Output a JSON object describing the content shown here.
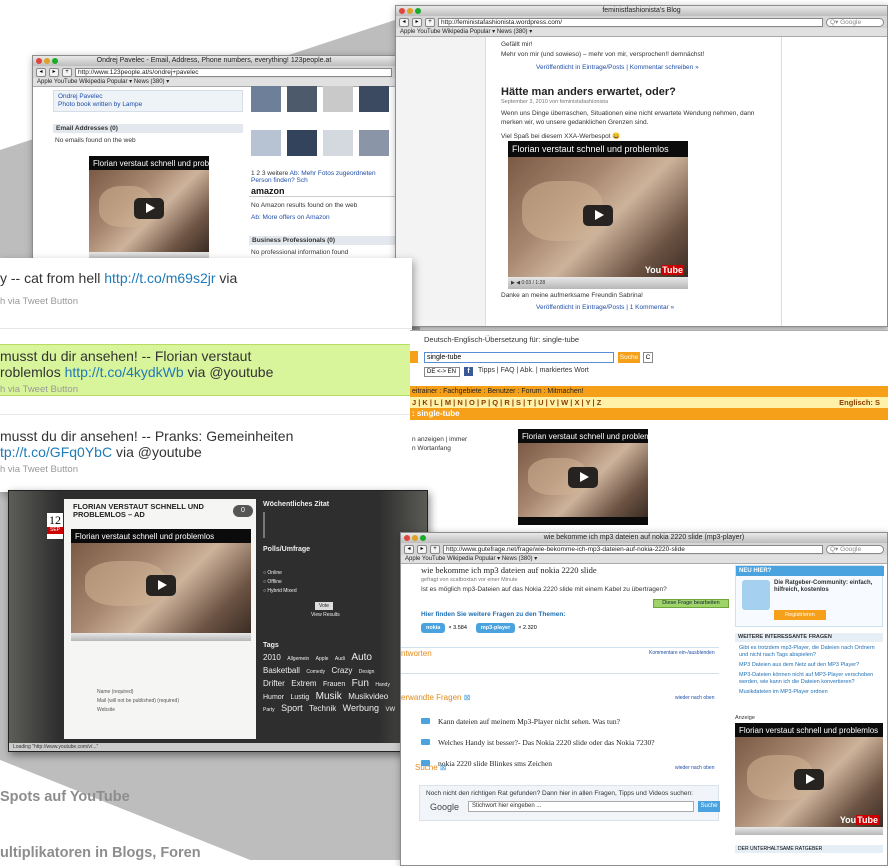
{
  "screen_123people": {
    "title": "Ondrej Pavelec - Email, Address, Phone numbers, everything! 123people.at",
    "url": "http://www.123people.at/s/ondrej+pavelec",
    "bookmarks": "Apple  YouTube  Wikipedia  Popular ▾  News (380) ▾",
    "link_top": "Ondrej Pavelec",
    "link_top2": "Photo book written by Lampe",
    "email_header": "Email Addresses (0)",
    "email_none": "No emails found on the web",
    "video_title": "Florian verstaut schnell und problemlos",
    "pagination": "1 2 3 weitere",
    "more_photos": "Ab: Mehr Fotos zugeordneten Person finden? Sch",
    "amazon_header": "amazon",
    "amazon_none": "No Amazon results found on the web",
    "amazon_link": "Ab: More offers on Amazon",
    "business_header": "Business Professionals (0)",
    "business_none": "No professional information found"
  },
  "screen_blog": {
    "title": "feministfashionista's Blog",
    "url": "http://feministafashionista.wordpress.com/",
    "search_placeholder": "Q▾ Google",
    "bookmarks": "Apple  YouTube  Wikipedia  Popular ▾  News (380) ▾",
    "prev_line1": "Gefällt mir!",
    "prev_line2": "Mehr von mir (und sowieso) – mehr von mir, versprochen!! demnächst!",
    "posted1": "Veröffentlicht in Eintrage/Posts | Kommentar schreiben »",
    "post_title": "Hätte man anders erwartet, oder?",
    "post_date": "September 3, 2010 von feministafashionista",
    "post_body": "Wenn uns Dinge überraschen, Situationen eine nicht erwartete Wendung nehmen, dann merken wir, wo unsere gedanklichen Grenzen sind.",
    "post_fun": "Viel Spaß bei diesem XXA-Werbespot 😀",
    "video_title": "Florian verstaut schnell und problemlos",
    "video_time": "0:03 / 1:28",
    "thanks": "Danke an meine aufmerksame Freundin Sabrina!",
    "posted2": "Veröffentlicht in Eintrage/Posts | 1 Kommentar »"
  },
  "tweets": [
    {
      "text": "y -- cat from hell ",
      "link": "http://t.co/m69s2jr",
      "after": " via",
      "meta": "h via Tweet Button"
    },
    {
      "text": "musst du dir ansehen! -- Florian verstaut",
      "text2": "roblemlos ",
      "link": "http://t.co/4kydkWb",
      "after": " via @youtube",
      "meta": "h via Tweet Button"
    },
    {
      "text": "musst du dir ansehen! -- Pranks: Gemeinheiten",
      "text2": "tp://t.co/GFq0YbC",
      "after": " via @youtube",
      "meta": "h via Tweet Button"
    }
  ],
  "screen_dict": {
    "heading": "Deutsch-Englisch-Übersetzung für: single-tube",
    "search_value": "single-tube",
    "search_button": "Suche",
    "lang_select": "DE <-> EN",
    "links": "Tipps | FAQ | Abk. | markiertes Wort",
    "nav": "eitrainer : Fachgebiete : Benutzer : Forum : Mitmachen!",
    "alphabet": "J | K | L | M | N | O | P | Q | R | S | T | U | V | W | X | Y | Z",
    "lang_right": "Englisch: S",
    "result": ": single-tube",
    "side1": "n anzeigen | immer",
    "side2": "n Wortanfang",
    "video_title": "Florian verstaut schnell und problemlos"
  },
  "screen_dark_blog": {
    "date_day": "12",
    "date_month": "SEP",
    "post_title": "FLORIAN VERSTAUT SCHNELL UND PROBLEMLOS – AD",
    "comments": "0",
    "video_title": "Florian verstaut schnell und problemlos",
    "sidebar_quote_title": "Wöchentliches Zitat",
    "poll_title": "Polls/Umfrage",
    "poll_options": [
      "Online",
      "Offline",
      "Hybrid Mixed"
    ],
    "vote_button": "Vote",
    "view_results": "View Results",
    "tags_title": "Tags",
    "tags": [
      "2010",
      "Allgemein",
      "Apple",
      "Audi",
      "Auto",
      "Basketball",
      "Comedy",
      "Crazy",
      "Design",
      "Drifter",
      "Extrem",
      "Frauen",
      "Fun",
      "Handy",
      "Humor",
      "Lustig",
      "Musik",
      "Musikvideo",
      "Party",
      "Sport",
      "Technik",
      "Werbung",
      "VW"
    ],
    "form_name": "Name (required)",
    "form_mail": "Mail (will not be published) (required)",
    "form_web": "Website",
    "status": "Loading \"http://www.youtube.com/v/...\""
  },
  "screen_gutefrage": {
    "title": "wie bekomme ich mp3 dateien auf nokia 2220 slide (mp3-player)",
    "url": "http://www.gutefrage.net/frage/wie-bekomme-ich-mp3-dateien-auf-nokia-2220-slide",
    "search_placeholder": "Q▾ Google",
    "bookmarks": "Apple  YouTube  Wikipedia  Popular ▾  News (380) ▾",
    "question": "wie bekomme ich mp3 dateien auf nokia 2220 slide",
    "asked_by": "gefragt von  scatboxtan  vor einer Minute",
    "question_body": "Ist es möglich mp3-Dateien auf das Nokia 2220 slide mit einem Kabel zu übertragen?",
    "edit_button": "Diese Frage bearbeiten",
    "more_questions": "Hier finden Sie weitere Fragen zu den Themen:",
    "topic1": "nokia",
    "topic1_count": "× 3.584",
    "topic2": "mp3-player",
    "topic2_count": "× 2.320",
    "answers": "ntworten",
    "comments_link": "Kommentare ein-/ausblenden",
    "related_header": "erwandte Fragen",
    "related_link": "wieder nach oben",
    "related": [
      "Kann dateien auf meinem Mp3-Player nicht sehen. Was tun?",
      "Welches Handy ist besser?- Das Nokia 2220 slide oder das Nokia 7230?",
      "nokia 2220 slide Blinkes sms Zeichen"
    ],
    "search_header": "Suche",
    "search_text": "Noch nicht den richtigen Rat gefunden? Dann hier in allen Fragen, Tipps und Videos suchen:",
    "google_label": "Google",
    "search_input": "Stichwort hier eingeben ...",
    "search_button": "Suche",
    "new_here": "NEU HIER?",
    "community": "Die Ratgeber-Community: einfach, hilfreich, kostenlos",
    "register": "Registrieren",
    "further_header": "WEITERE INTERESSANTE FRAGEN",
    "further": [
      "Gibt es trotzdem mp3-Player, die Dateien nach Ordnern und nicht nach Tags abspielen?",
      "MP3 Dateien aus dem Netz auf den MP3 Player?",
      "MP3-Dateien können nicht auf MP3-Player verschoben werden, wie kann ich die Dateien konvertieren?",
      "Musikdateien im MP3-Player ordnen"
    ],
    "ad_label": "Anzeige",
    "video_title": "Florian verstaut schnell und problemlos",
    "footer_label": "DER UNTERHALTSAME RATGEBER"
  },
  "captions": {
    "line1": "Spots auf YouTube",
    "line2": "ultiplikatoren in Blogs, Foren"
  },
  "colors": {
    "highlight_green": "#d9f59c",
    "dict_orange": "#f6a01a",
    "gutefrage_blue": "#4aa3df",
    "link_blue": "#1f4ea8",
    "caption_gray": "#8d8d8d",
    "beam_gray": "#bdbdbd"
  }
}
